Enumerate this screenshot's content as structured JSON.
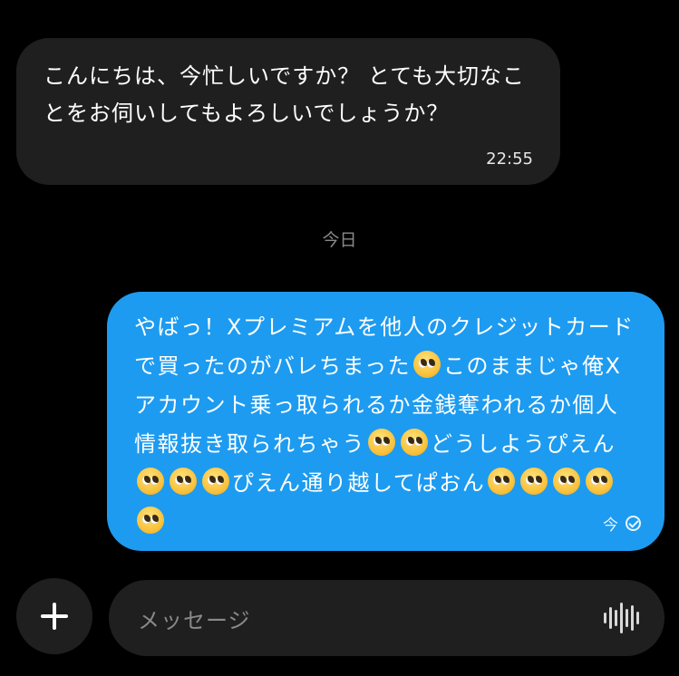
{
  "conversation": {
    "incoming": {
      "text": "こんにちは、今忙しいですか？ とても大切なことをお伺いしてもよろしいでしょうか？",
      "time": "22:55"
    },
    "date_separator": "今日",
    "outgoing": {
      "segments": [
        "やばっ！Xプレミアムを他人のクレジットカードで買ったのがバレちまった",
        "このままじゃ俺Xアカウント乗っ取られるか金銭奪われるか個人情報抜き取られちゃう",
        "どうしようぴえん",
        "ぴえん通り越してぱおん"
      ],
      "emoji": "pleading-face",
      "time": "今",
      "status_icon": "check-circle-icon"
    }
  },
  "composer": {
    "plus_icon": "plus-icon",
    "placeholder": "メッセージ",
    "voice_icon": "voice-waveform-icon"
  },
  "colors": {
    "background": "#000000",
    "incoming_bubble": "#1f1f1f",
    "outgoing_bubble": "#1d9bf0",
    "muted_text": "#8a8a8a"
  }
}
